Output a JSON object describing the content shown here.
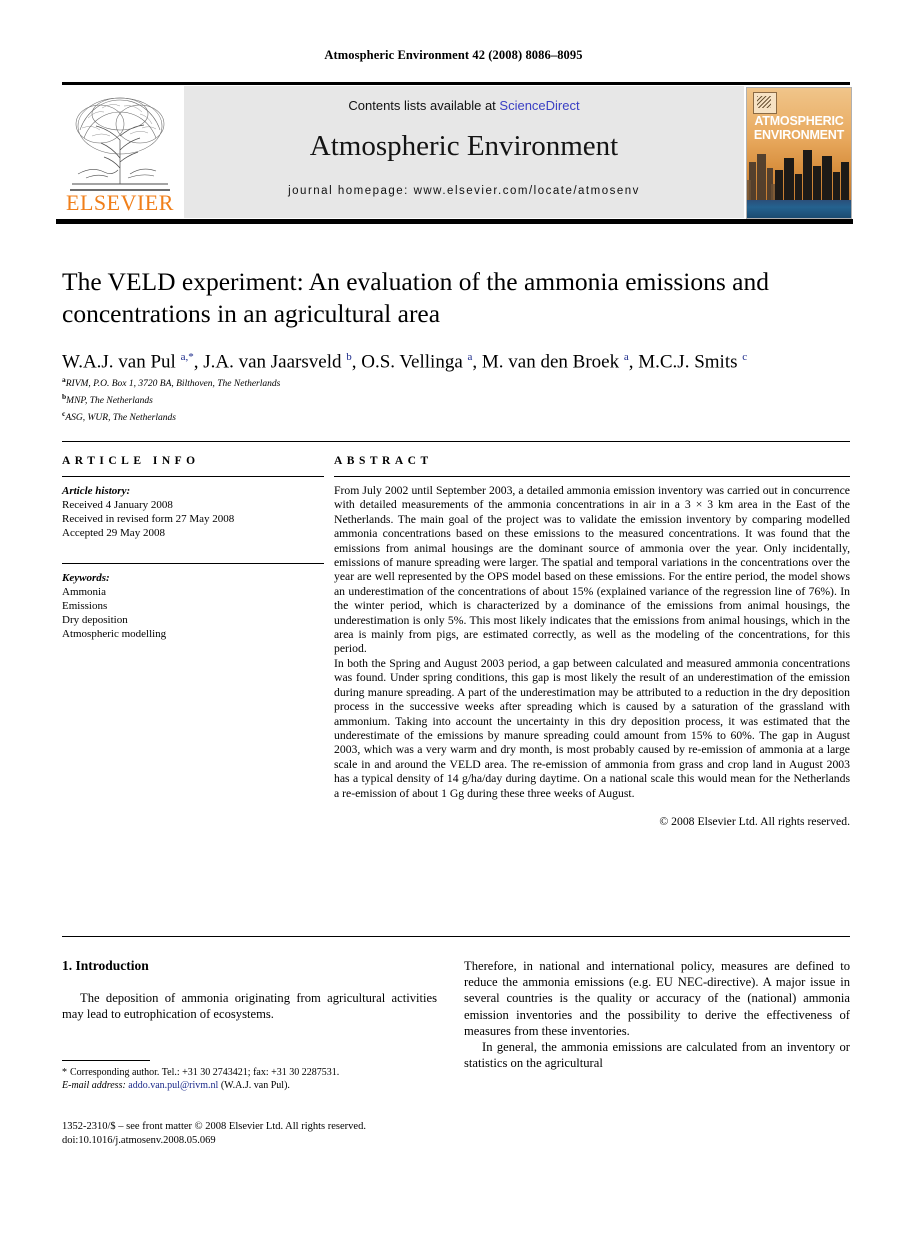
{
  "running_head": "Atmospheric Environment 42 (2008) 8086–8095",
  "masthead": {
    "contents_prefix": "Contents lists available at ",
    "sciencedirect": "ScienceDirect",
    "journal_name": "Atmospheric Environment",
    "homepage": "journal homepage: www.elsevier.com/locate/atmosenv",
    "publisher_wordmark": "ELSEVIER",
    "cover_title_line1": "ATMOSPHERIC",
    "cover_title_line2": "ENVIRONMENT",
    "link_color": "#3A3FC4",
    "publisher_color": "#F07F1A"
  },
  "article": {
    "title": "The VELD experiment: An evaluation of the ammonia emissions and concentrations in an agricultural area",
    "authors_html": "W.A.J. van Pul <sup>a,</sup><sup>*</sup>, J.A. van Jaarsveld <sup>b</sup>, O.S. Vellinga <sup>a</sup>, M. van den Broek <sup>a</sup>, M.C.J. Smits <sup>c</sup>",
    "affiliations": [
      {
        "mark": "a",
        "text": "RIVM, P.O. Box 1, 3720 BA, Bilthoven, The Netherlands"
      },
      {
        "mark": "b",
        "text": "MNP, The Netherlands"
      },
      {
        "mark": "c",
        "text": "ASG, WUR, The Netherlands"
      }
    ]
  },
  "article_info": {
    "heading": "ARTICLE INFO",
    "history_label": "Article history:",
    "history": [
      "Received 4 January 2008",
      "Received in revised form 27 May 2008",
      "Accepted 29 May 2008"
    ],
    "keywords_label": "Keywords:",
    "keywords": [
      "Ammonia",
      "Emissions",
      "Dry deposition",
      "Atmospheric modelling"
    ]
  },
  "abstract": {
    "heading": "ABSTRACT",
    "paragraphs": [
      "From July 2002 until September 2003, a detailed ammonia emission inventory was carried out in concurrence with detailed measurements of the ammonia concentrations in air in a 3 × 3 km area in the East of the Netherlands. The main goal of the project was to validate the emission inventory by comparing modelled ammonia concentrations based on these emissions to the measured concentrations. It was found that the emissions from animal housings are the dominant source of ammonia over the year. Only incidentally, emissions of manure spreading were larger. The spatial and temporal variations in the concentrations over the year are well represented by the OPS model based on these emissions. For the entire period, the model shows an underestimation of the concentrations of about 15% (explained variance of the regression line of 76%). In the winter period, which is characterized by a dominance of the emissions from animal housings, the underestimation is only 5%. This most likely indicates that the emissions from animal housings, which in the area is mainly from pigs, are estimated correctly, as well as the modeling of the concentrations, for this period.",
      "In both the Spring and August 2003 period, a gap between calculated and measured ammonia concentrations was found. Under spring conditions, this gap is most likely the result of an underestimation of the emission during manure spreading. A part of the underestimation may be attributed to a reduction in the dry deposition process in the successive weeks after spreading which is caused by a saturation of the grassland with ammonium. Taking into account the uncertainty in this dry deposition process, it was estimated that the underestimate of the emissions by manure spreading could amount from 15% to 60%. The gap in August 2003, which was a very warm and dry month, is most probably caused by re-emission of ammonia at a large scale in and around the VELD area. The re-emission of ammonia from grass and crop land in August 2003 has a typical density of 14 g/ha/day during daytime. On a national scale this would mean for the Netherlands a re-emission of about 1 Gg during these three weeks of August."
    ],
    "copyright": "© 2008 Elsevier Ltd. All rights reserved."
  },
  "introduction": {
    "heading": "1. Introduction",
    "left_paragraph": "The deposition of ammonia originating from agricultural activities may lead to eutrophication of ecosystems.",
    "right_paragraph_1": "Therefore, in national and international policy, measures are defined to reduce the ammonia emissions (e.g. EU NEC-directive). A major issue in several countries is the quality or accuracy of the (national) ammonia emission inventories and the possibility to derive the effectiveness of measures from these inventories.",
    "right_paragraph_2": "In general, the ammonia emissions are calculated from an inventory or statistics on the agricultural"
  },
  "footnote": {
    "marker": "*",
    "corresponding": "Corresponding author. Tel.: +31 30 2743421; fax: +31 30 2287531.",
    "email_label": "E-mail address:",
    "email": "addo.van.pul@rivm.nl",
    "email_suffix": "(W.A.J. van Pul)."
  },
  "page_footer": {
    "line1": "1352-2310/$ – see front matter © 2008 Elsevier Ltd. All rights reserved.",
    "line2": "doi:10.1016/j.atmosenv.2008.05.069"
  }
}
